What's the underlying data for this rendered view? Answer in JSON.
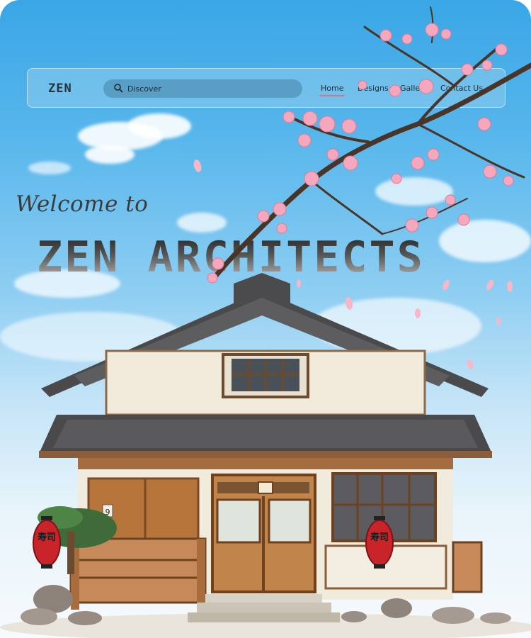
{
  "navbar": {
    "logo": "ZEN",
    "search": {
      "placeholder": "Discover",
      "icon": "search-icon"
    },
    "links": [
      {
        "label": "Home",
        "active": true
      },
      {
        "label": "Designs"
      },
      {
        "label": "Gallery"
      },
      {
        "label": "Contact Us"
      }
    ]
  },
  "hero": {
    "welcome": "Welcome to",
    "title": "ZEN ARCHITECTS"
  },
  "house": {
    "door_number": "9",
    "lantern_text": "寿司"
  },
  "colors": {
    "accent": "#d9708a",
    "sky_top": "#3aa6e6",
    "blossom": "#f4a7bd",
    "lantern": "#c8242a"
  }
}
